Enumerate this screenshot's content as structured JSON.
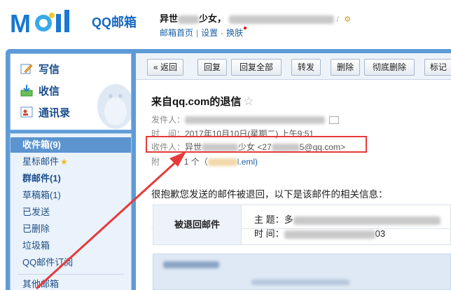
{
  "header": {
    "brand": "QQ邮箱",
    "user_name_prefix": "异世",
    "user_name_suffix": "少女，",
    "nav": {
      "home": "邮箱首页",
      "settings": "设置",
      "skin": "换肤"
    }
  },
  "sidebar": {
    "compose": "写信",
    "receive": "收信",
    "contacts": "通讯录",
    "folders": [
      {
        "label": "收件箱(9)"
      },
      {
        "label": "星标邮件"
      },
      {
        "label": "群邮件(1)"
      },
      {
        "label": "草稿箱(1)"
      },
      {
        "label": "已发送"
      },
      {
        "label": "已删除"
      },
      {
        "label": "垃圾箱"
      },
      {
        "label": "QQ邮件订阅"
      },
      {
        "label": "其他邮箱"
      }
    ]
  },
  "toolbar": {
    "back": "« 返回",
    "reply": "回复",
    "reply_all": "回复全部",
    "forward": "转发",
    "delete": "删除",
    "delete_forever": "彻底删除",
    "mark": "标记"
  },
  "message": {
    "subject": "来自qq.com的退信",
    "sender_label": "发件人：",
    "time_label": "时　间：",
    "time_value": "2017年10月10日(星期二) 上午9:51",
    "recipient_label": "收件人：",
    "recipient_prefix": "异世",
    "recipient_suffix": "少女",
    "recipient_email_prefix": "<27",
    "recipient_email_suffix": "5@qq.com>",
    "attachment_label": "附",
    "attachment_count": "1 个（",
    "attachment_file": "l.eml)",
    "notice": "很抱歉您发送的邮件被退回，以下是该邮件的相关信息：",
    "bounced_header": "被退回邮件",
    "bounced_subject_label": "主 题：多",
    "bounced_time_label": "时 间：",
    "bounced_time_tail": "03"
  },
  "colors": {
    "brand_blue": "#1768c1",
    "frame_blue": "#5d9bd6",
    "highlight_red": "#e63a3a"
  }
}
